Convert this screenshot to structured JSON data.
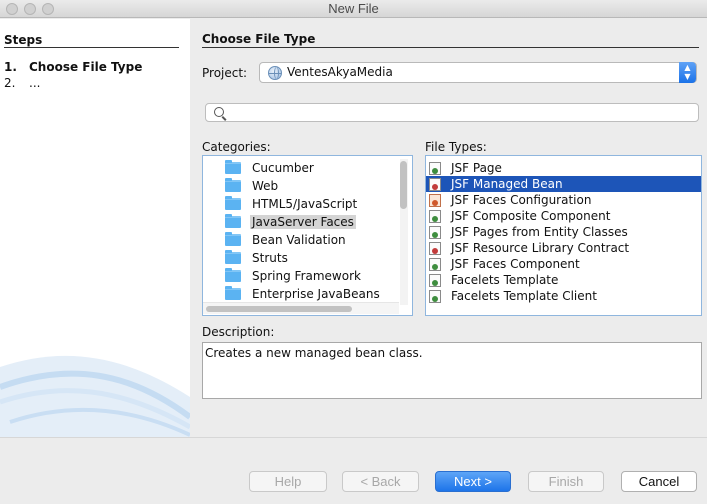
{
  "window": {
    "title": "New File"
  },
  "steps": {
    "heading": "Steps",
    "items": [
      {
        "num": "1.",
        "label": "Choose File Type"
      },
      {
        "num": "2.",
        "label": "..."
      }
    ]
  },
  "main": {
    "heading": "Choose File Type",
    "project": {
      "label": "Project:",
      "value": "VentesAkyaMedia"
    },
    "search": {
      "value": ""
    },
    "categories": {
      "label": "Categories:",
      "items": [
        "Cucumber",
        "Web",
        "HTML5/JavaScript",
        "JavaServer Faces",
        "Bean Validation",
        "Struts",
        "Spring Framework",
        "Enterprise JavaBeans"
      ],
      "selected": "JavaServer Faces"
    },
    "file_types": {
      "label": "File Types:",
      "items": [
        "JSF Page",
        "JSF Managed Bean",
        "JSF Faces Configuration",
        "JSF Composite Component",
        "JSF Pages from Entity Classes",
        "JSF Resource Library Contract",
        "JSF Faces Component",
        "Facelets Template",
        "Facelets Template Client"
      ],
      "selected": "JSF Managed Bean"
    },
    "description": {
      "label": "Description:",
      "text": "Creates a new managed bean class."
    }
  },
  "buttons": {
    "help": "Help",
    "back": "< Back",
    "next": "Next >",
    "finish": "Finish",
    "cancel": "Cancel"
  }
}
